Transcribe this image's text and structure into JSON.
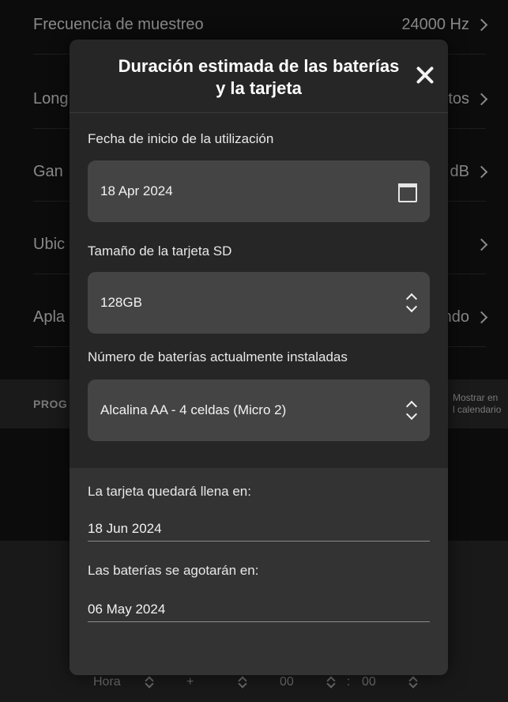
{
  "background": {
    "rows": [
      {
        "label": "Frecuencia de muestreo",
        "value": "24000 Hz"
      },
      {
        "label": "Long",
        "value": "tos"
      },
      {
        "label": "Gan",
        "value": "dB"
      },
      {
        "label": "Ubic",
        "value": ""
      },
      {
        "label": "Apla",
        "value": "ndo"
      }
    ],
    "section": {
      "title": "PROG",
      "side_line1": "Mostrar en",
      "side_line2": "l calendario"
    },
    "bottom": {
      "hour_label": "Hora",
      "plus_label": "+",
      "minutes": "00",
      "separator": ":",
      "seconds": "00"
    }
  },
  "modal": {
    "title": "Duración estimada de las baterías y la tarjeta",
    "close_icon": "close-icon",
    "start_date": {
      "label": "Fecha de inicio de la utilización",
      "value": "18 Apr 2024",
      "icon": "calendar-icon"
    },
    "sd_size": {
      "label": "Tamaño de la tarjeta SD",
      "value": "128GB"
    },
    "batteries": {
      "label": "Número de baterías actualmente instaladas",
      "value": "Alcalina AA - 4 celdas (Micro 2)"
    },
    "card_full": {
      "label": "La tarjeta quedará llena en:",
      "value": "18 Jun 2024"
    },
    "battery_empty": {
      "label": "Las baterías se agotarán en:",
      "value": "06 May 2024"
    }
  },
  "colors": {
    "modal_bg": "#262626",
    "field_bg": "#444444",
    "result_bg": "#333333",
    "page_bg": "#0c0c0c"
  }
}
